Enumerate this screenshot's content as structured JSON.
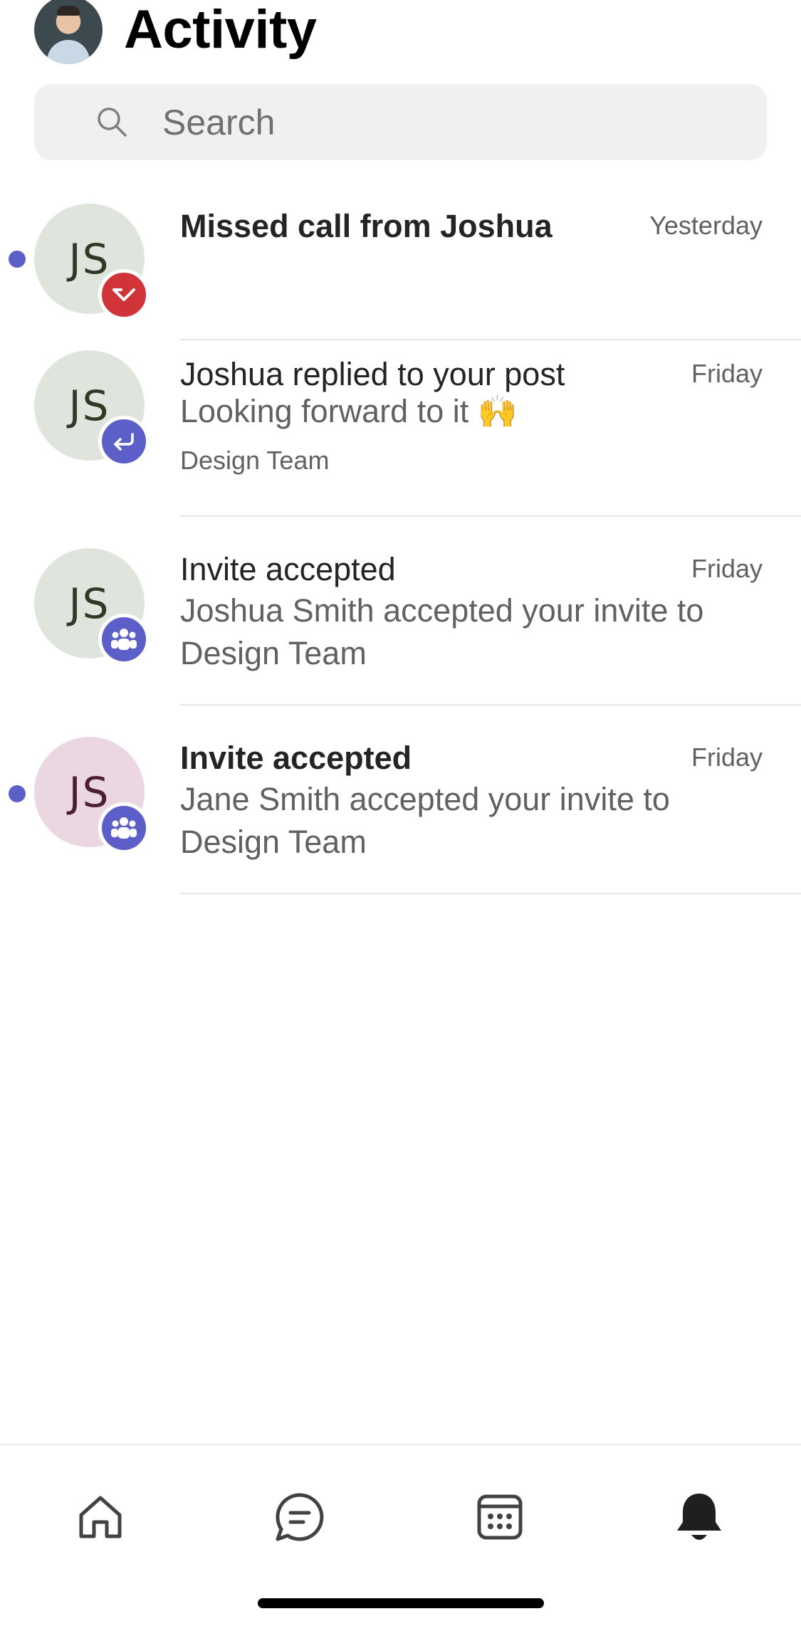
{
  "header": {
    "title": "Activity"
  },
  "search": {
    "placeholder": "Search"
  },
  "activities": [
    {
      "title": "Missed call from Joshua",
      "time": "Yesterday",
      "initials": "JS",
      "unread": true,
      "type": "missed-call"
    },
    {
      "title": "Joshua replied to your post",
      "time": "Friday",
      "initials": "JS",
      "unread": false,
      "type": "reply",
      "message": "Looking forward to it 🙌",
      "channel": "Design Team"
    },
    {
      "title": "Invite accepted",
      "time": "Friday",
      "initials": "JS",
      "unread": false,
      "type": "team",
      "message": "Joshua Smith accepted your invite to Design Team"
    },
    {
      "title": "Invite accepted",
      "time": "Friday",
      "initials": "JS",
      "unread": true,
      "type": "team",
      "message": "Jane Smith accepted your invite to Design Team"
    }
  ],
  "nav": [
    "home-icon",
    "chat-icon",
    "calendar-icon",
    "bell-icon"
  ],
  "colors": {
    "accent": "#5b5fc7",
    "missed": "#d13438",
    "avatar_green": "#dfe5dc",
    "avatar_pink": "#ead7e1"
  }
}
